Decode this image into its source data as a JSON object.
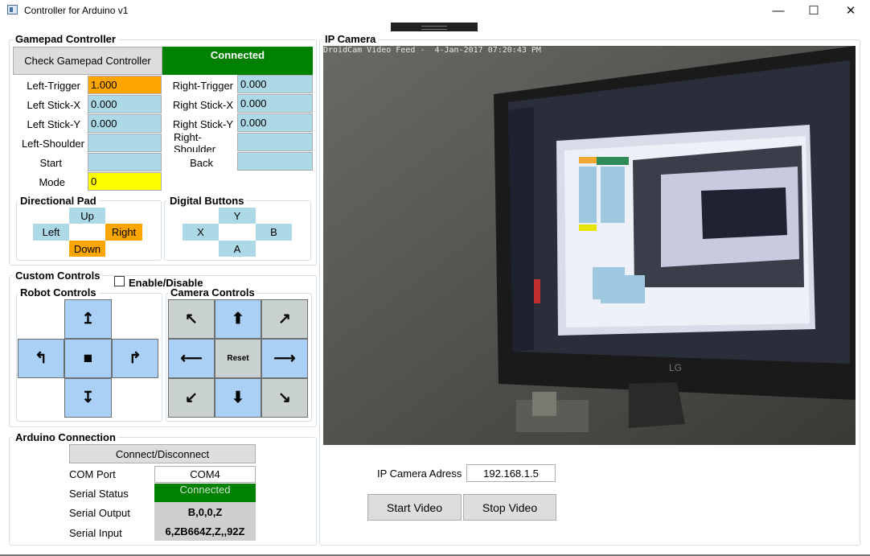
{
  "window": {
    "title": "Controller for Arduino v1",
    "minimize": "—",
    "maximize": "☐",
    "close": "✕"
  },
  "gamepad": {
    "title": "Gamepad Controller",
    "check_button": "Check Gamepad Controller",
    "status": "Connected",
    "left_trigger": {
      "label": "Left-Trigger",
      "value": "1.000"
    },
    "right_trigger": {
      "label": "Right-Trigger",
      "value": "0.000"
    },
    "left_stick_x": {
      "label": "Left Stick-X",
      "value": "0.000"
    },
    "right_stick_x": {
      "label": "Right Stick-X",
      "value": "0.000"
    },
    "left_stick_y": {
      "label": "Left Stick-Y",
      "value": "0.000"
    },
    "right_stick_y": {
      "label": "Right Stick-Y",
      "value": "0.000"
    },
    "left_shoulder": {
      "label": "Left-Shoulder",
      "value": ""
    },
    "right_shoulder": {
      "label": "Right-Shoulder",
      "value": ""
    },
    "start": {
      "label": "Start",
      "value": ""
    },
    "back": {
      "label": "Back",
      "value": ""
    },
    "mode": {
      "label": "Mode",
      "value": "0"
    },
    "dpad": {
      "title": "Directional Pad",
      "up": "Up",
      "left": "Left",
      "right": "Right",
      "down": "Down"
    },
    "digital": {
      "title": "Digital Buttons",
      "y": "Y",
      "x": "X",
      "b": "B",
      "a": "A"
    }
  },
  "custom": {
    "title": "Custom Controls",
    "enable_label": "Enable/Disable",
    "robot": {
      "title": "Robot Controls",
      "forward": "↥",
      "left": "↰",
      "stop": "■",
      "right": "↱",
      "reverse": "↧"
    },
    "camera": {
      "title": "Camera Controls",
      "up_left": "↖",
      "up": "⬆",
      "up_right": "↗",
      "left": "⟵",
      "reset": "Reset",
      "right": "⟶",
      "down_left": "↙",
      "down": "⬇",
      "down_right": "↘"
    }
  },
  "arduino": {
    "title": "Arduino Connection",
    "connect_button": "Connect/Disconnect",
    "com_port_label": "COM Port",
    "com_port": "COM4",
    "serial_status_label": "Serial Status",
    "serial_status": "Connected",
    "serial_output_label": "Serial Output",
    "serial_output": "B,0,0,Z",
    "serial_input_label": "Serial Input",
    "serial_input": "6,ZB664Z,Z,,92Z"
  },
  "ipcam": {
    "title": "IP Camera",
    "overlay": "DroidCam Video Feed -  4-Jan-2017 07:20:43 PM",
    "address_label": "IP Camera Adress",
    "address": "192.168.1.5",
    "start_button": "Start Video",
    "stop_button": "Stop Video"
  },
  "colors": {
    "field_blue": "#add8e6",
    "control_blue": "#aad0f5",
    "active_orange": "#ffa500",
    "mode_yellow": "#ffff00",
    "status_green": "#008000",
    "reset_grey": "#c9d1d1"
  }
}
